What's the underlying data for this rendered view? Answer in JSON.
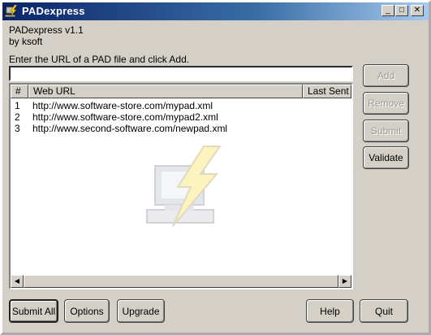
{
  "window": {
    "title": "PADexpress"
  },
  "titlebar_buttons": {
    "minimize": "_",
    "maximize": "□",
    "close": "✕"
  },
  "header": {
    "app_version": "PADexpress v1.1",
    "author": "by ksoft"
  },
  "instruction": "Enter the URL of a PAD file and click Add.",
  "url_input": {
    "value": "",
    "placeholder": ""
  },
  "list": {
    "columns": [
      "#",
      "Web URL",
      "Last Sent"
    ],
    "rows": [
      {
        "num": "1",
        "url": "http://www.software-store.com/mypad.xml",
        "last_sent": ""
      },
      {
        "num": "2",
        "url": "http://www.software-store.com/mypad2.xml",
        "last_sent": ""
      },
      {
        "num": "3",
        "url": "http://www.second-software.com/newpad.xml",
        "last_sent": ""
      }
    ]
  },
  "side_buttons": {
    "add": "Add",
    "remove": "Remove",
    "submit": "Submit",
    "validate": "Validate"
  },
  "bottom_buttons": {
    "submit_all": "Submit All",
    "options": "Options",
    "upgrade": "Upgrade",
    "help": "Help",
    "quit": "Quit"
  },
  "icons": {
    "app": "pad-lightning-icon",
    "watermark": "pad-computer-lightning-icon"
  },
  "colors": {
    "titlebar_start": "#0a246a",
    "titlebar_end": "#a6caf0",
    "face": "#d4d0c8",
    "disabled_text": "#9c9a95"
  }
}
